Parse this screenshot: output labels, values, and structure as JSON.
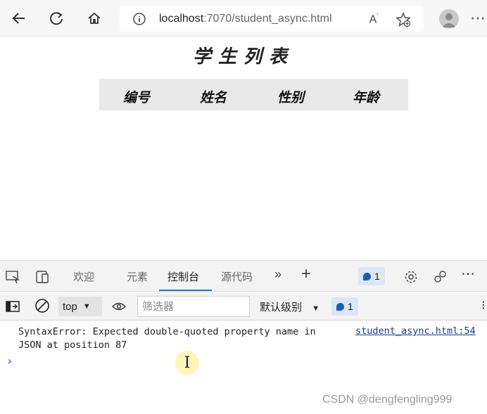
{
  "browser": {
    "url_host": "localhost",
    "url_rest": ":7070/student_async.html"
  },
  "page": {
    "title": "学生列表",
    "columns": [
      "编号",
      "姓名",
      "性别",
      "年龄"
    ]
  },
  "devtools": {
    "tabs": [
      "欢迎",
      "元素",
      "控制台",
      "源代码"
    ],
    "active_tab": "控制台",
    "issues_count": "1",
    "context": "top",
    "filter_placeholder": "筛选器",
    "levels_label": "默认级别",
    "toolbar_issues_count": "1",
    "console": {
      "error_line1": "SyntaxError: Expected double-quoted property name in",
      "error_line2": "JSON at position 87",
      "source_link": "student_async.html:54",
      "prompt": "›"
    }
  },
  "watermark": "CSDN @dengfengling999"
}
